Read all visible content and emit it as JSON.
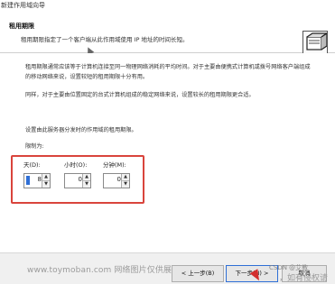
{
  "window": {
    "title": "新建作用域向导"
  },
  "header": {
    "title": "租用期限",
    "subtitle": "租用期限指定了一个客户端从此作用域使用 IP 地址的时间长短。",
    "icon": "wizard-network-icon"
  },
  "body": {
    "paragraph1": "租用期限通常应该等于计算机连接至同一物理网络消耗的平均时间。对于主要由便携式计算机或拨号网络客户端组成的移动网络来说，设置较短的租用期限十分有用。",
    "paragraph2": "同样，对于主要由位置固定的台式计算机组成的稳定网络来说，设置较长的租用期限更合适。",
    "paragraph3": "设置由此服务器分发时的作用域的租用期限。",
    "limit_label": "限制为:",
    "fields": {
      "days": {
        "label": "天(D):",
        "value": "8"
      },
      "hours": {
        "label": "小时(O):",
        "value": "0"
      },
      "minutes": {
        "label": "分钟(M):",
        "value": "0"
      }
    }
  },
  "footer": {
    "back_label": "< 上一步(B)",
    "next_label": "下一步(N) >",
    "cancel_label": "取消",
    "watermark_left": "www.toymoban.com 网络图片仅供展示，非",
    "watermark_csdn": "CSDN @艾教",
    "watermark_right": "，如有侵权请"
  },
  "colors": {
    "highlight_border": "#d9443c",
    "accent": "#2f6fd6"
  }
}
